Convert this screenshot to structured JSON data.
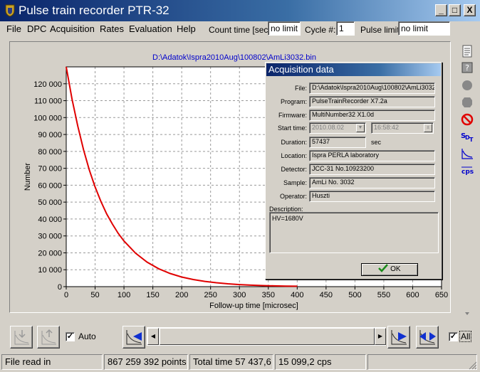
{
  "window": {
    "title": "Pulse train recorder PTR-32",
    "minimize_label": "_",
    "maximize_label": "□",
    "close_label": "X"
  },
  "menu": {
    "items": [
      "File",
      "DPC",
      "Acquisition",
      "Rates",
      "Evaluation",
      "Help"
    ]
  },
  "toolbar": {
    "count_time_label": "Count time [sec]:",
    "count_time_value": "no limit",
    "cycle_label": "Cycle #:",
    "cycle_value": "1",
    "pulse_limit_label": "Pulse limit:",
    "pulse_limit_value": "no limit"
  },
  "file_path": "D:\\Adatok\\Ispra2010Aug\\100802\\AmLi3032.bin",
  "chart_data": {
    "type": "line",
    "xlabel": "Follow-up time [microsec]",
    "ylabel": "Number",
    "xlim": [
      0,
      650
    ],
    "ylim": [
      0,
      130000
    ],
    "x_ticks": [
      0,
      50,
      100,
      150,
      200,
      250,
      300,
      350,
      400,
      450,
      500,
      550,
      600,
      650
    ],
    "y_ticks": [
      0,
      10000,
      20000,
      30000,
      40000,
      50000,
      60000,
      70000,
      80000,
      90000,
      100000,
      110000,
      120000
    ],
    "x_tick_labels": [
      "0",
      "50",
      "100",
      "150",
      "200",
      "250",
      "300",
      "350",
      "400",
      "450",
      "500",
      "550",
      "600",
      "650"
    ],
    "y_tick_labels": [
      "0",
      "10 000",
      "20 000",
      "30 000",
      "40 000",
      "50 000",
      "60 000",
      "70 000",
      "80 000",
      "90 000",
      "100 000",
      "110 000",
      "120 000"
    ],
    "grid": true,
    "series": [
      {
        "color": "#e00000",
        "x": [
          0,
          10,
          20,
          30,
          40,
          50,
          60,
          70,
          80,
          90,
          100,
          120,
          140,
          160,
          180,
          200,
          220,
          240,
          260,
          280,
          300,
          320,
          340,
          360,
          380,
          400
        ],
        "y": [
          130000,
          111000,
          95000,
          81000,
          69000,
          59000,
          50500,
          43000,
          37000,
          31500,
          27000,
          19800,
          14500,
          10600,
          7800,
          5700,
          4200,
          3100,
          2300,
          1700,
          1200,
          900,
          650,
          480,
          350,
          250
        ]
      }
    ]
  },
  "dialog": {
    "title": "Acquisition data",
    "fields": [
      {
        "label": "File:",
        "value": "D:\\Adatok\\Ispra2010Aug\\100802\\AmLi3032.bi"
      },
      {
        "label": "Program:",
        "value": "PulseTrainRecorder X7.2a"
      },
      {
        "label": "Firmware:",
        "value": "MultiNumber32  X1.0d"
      },
      {
        "label": "Start time:",
        "value": "2010.08.02"
      },
      {
        "label": "Duration:",
        "value": "57437"
      },
      {
        "label": "Location:",
        "value": "Ispra PERLA laboratory"
      },
      {
        "label": "Detector:",
        "value": "JCC-31 No.10923200"
      },
      {
        "label": "Sample:",
        "value": "AmLi  No. 3032"
      },
      {
        "label": "Operator:",
        "value": "Huszti"
      }
    ],
    "start_time_clock": "16:58:42",
    "duration_unit": "sec",
    "description_label": "Description:",
    "description_value": "HV=1680V",
    "ok_label": "OK"
  },
  "bottom": {
    "auto_label": "Auto",
    "all_label": "All"
  },
  "status": {
    "cells": [
      "File read in",
      "867 259 392 points",
      "Total time 57 437,6",
      "15 099,2 cps"
    ]
  },
  "side_icons": [
    "document-icon",
    "help-icon",
    "record-icon",
    "stop-icon",
    "cancel-icon",
    "sdt-icon",
    "decay-curve-icon",
    "cps-icon"
  ]
}
